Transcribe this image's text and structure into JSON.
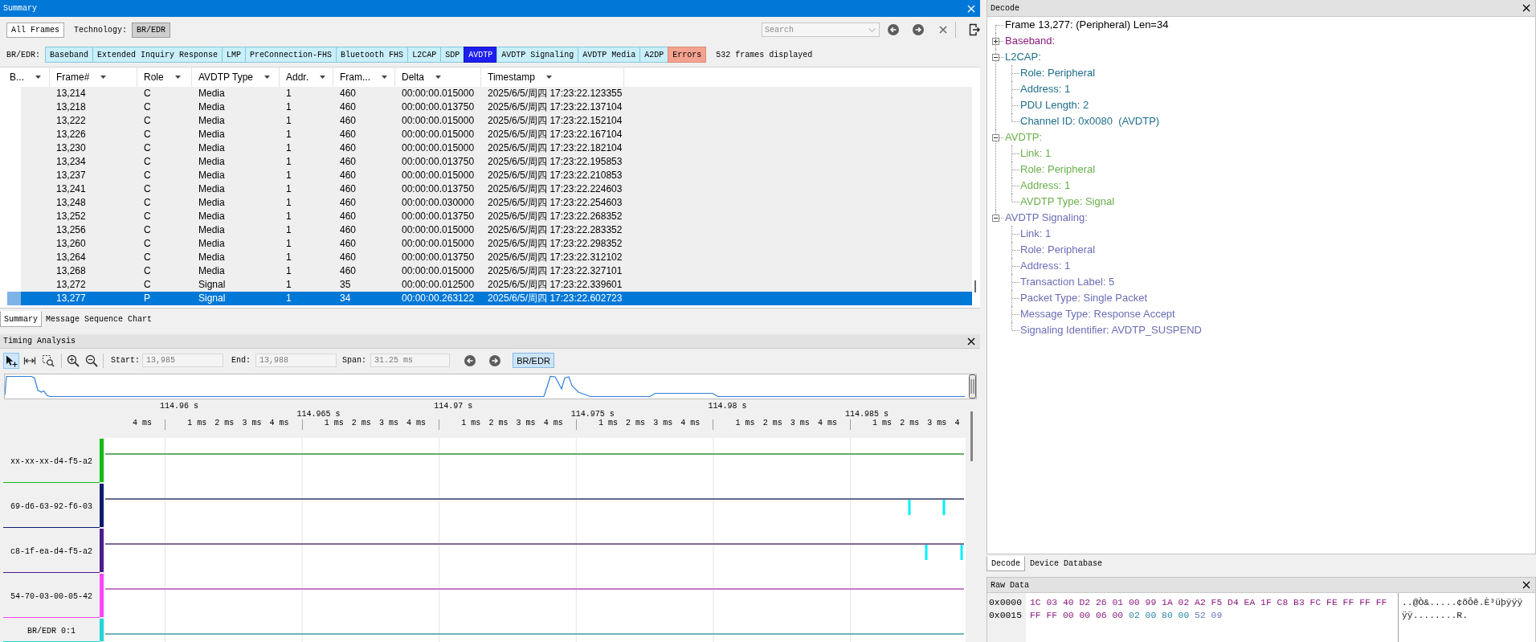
{
  "summary": {
    "title": "Summary",
    "all_frames_button": "All Frames",
    "technology_label": "Technology:",
    "technology_button": "BR/EDR",
    "search": {
      "placeholder": "Search"
    },
    "protocol_label": "BR/EDR:",
    "protocol_tabs": [
      {
        "label": "Baseband",
        "kind": "protocol",
        "selected": false
      },
      {
        "label": "Extended Inquiry Response",
        "kind": "protocol",
        "selected": false
      },
      {
        "label": "LMP",
        "kind": "protocol",
        "selected": false
      },
      {
        "label": "PreConnection-FHS",
        "kind": "protocol",
        "selected": false
      },
      {
        "label": "Bluetooth FHS",
        "kind": "protocol",
        "selected": false
      },
      {
        "label": "L2CAP",
        "kind": "protocol",
        "selected": false
      },
      {
        "label": "SDP",
        "kind": "protocol",
        "selected": false
      },
      {
        "label": "AVDTP",
        "kind": "protocol",
        "selected": true
      },
      {
        "label": "AVDTP Signaling",
        "kind": "protocol",
        "selected": false
      },
      {
        "label": "AVDTP Media",
        "kind": "protocol",
        "selected": false
      },
      {
        "label": "A2DP",
        "kind": "protocol",
        "selected": false
      },
      {
        "label": "Errors",
        "kind": "error",
        "selected": false
      }
    ],
    "frames_count": "532 frames displayed",
    "table": {
      "columns": [
        "B...",
        "Frame#",
        "Role",
        "AVDTP Type",
        "Addr.",
        "Fram...",
        "Delta",
        "Timestamp"
      ],
      "rows": [
        {
          "cells": [
            "",
            "13,214",
            "C",
            "Media",
            "1",
            "460",
            "00:00:00.015000",
            "2025/6/5/周四 17:23:22.123355"
          ],
          "selected": false
        },
        {
          "cells": [
            "",
            "13,218",
            "C",
            "Media",
            "1",
            "460",
            "00:00:00.013750",
            "2025/6/5/周四 17:23:22.137104"
          ],
          "selected": false
        },
        {
          "cells": [
            "",
            "13,222",
            "C",
            "Media",
            "1",
            "460",
            "00:00:00.015000",
            "2025/6/5/周四 17:23:22.152104"
          ],
          "selected": false
        },
        {
          "cells": [
            "",
            "13,226",
            "C",
            "Media",
            "1",
            "460",
            "00:00:00.015000",
            "2025/6/5/周四 17:23:22.167104"
          ],
          "selected": false
        },
        {
          "cells": [
            "",
            "13,230",
            "C",
            "Media",
            "1",
            "460",
            "00:00:00.015000",
            "2025/6/5/周四 17:23:22.182104"
          ],
          "selected": false
        },
        {
          "cells": [
            "",
            "13,234",
            "C",
            "Media",
            "1",
            "460",
            "00:00:00.013750",
            "2025/6/5/周四 17:23:22.195853"
          ],
          "selected": false
        },
        {
          "cells": [
            "",
            "13,237",
            "C",
            "Media",
            "1",
            "460",
            "00:00:00.015000",
            "2025/6/5/周四 17:23:22.210853"
          ],
          "selected": false
        },
        {
          "cells": [
            "",
            "13,241",
            "C",
            "Media",
            "1",
            "460",
            "00:00:00.013750",
            "2025/6/5/周四 17:23:22.224603"
          ],
          "selected": false
        },
        {
          "cells": [
            "",
            "13,248",
            "C",
            "Media",
            "1",
            "460",
            "00:00:00.030000",
            "2025/6/5/周四 17:23:22.254603"
          ],
          "selected": false
        },
        {
          "cells": [
            "",
            "13,252",
            "C",
            "Media",
            "1",
            "460",
            "00:00:00.013750",
            "2025/6/5/周四 17:23:22.268352"
          ],
          "selected": false
        },
        {
          "cells": [
            "",
            "13,256",
            "C",
            "Media",
            "1",
            "460",
            "00:00:00.015000",
            "2025/6/5/周四 17:23:22.283352"
          ],
          "selected": false
        },
        {
          "cells": [
            "",
            "13,260",
            "C",
            "Media",
            "1",
            "460",
            "00:00:00.015000",
            "2025/6/5/周四 17:23:22.298352"
          ],
          "selected": false
        },
        {
          "cells": [
            "",
            "13,264",
            "C",
            "Media",
            "1",
            "460",
            "00:00:00.013750",
            "2025/6/5/周四 17:23:22.312102"
          ],
          "selected": false
        },
        {
          "cells": [
            "",
            "13,268",
            "C",
            "Media",
            "1",
            "460",
            "00:00:00.015000",
            "2025/6/5/周四 17:23:22.327101"
          ],
          "selected": false
        },
        {
          "cells": [
            "",
            "13,272",
            "C",
            "Signal",
            "1",
            "35",
            "00:00:00.012500",
            "2025/6/5/周四 17:23:22.339601"
          ],
          "selected": false
        },
        {
          "cells": [
            "",
            "13,277",
            "P",
            "Signal",
            "1",
            "34",
            "00:00:00.263122",
            "2025/6/5/周四 17:23:22.602723"
          ],
          "selected": true
        }
      ]
    },
    "view_tabs": [
      {
        "label": "Summary",
        "selected": true
      },
      {
        "label": "Message Sequence Chart",
        "selected": false
      }
    ]
  },
  "timing": {
    "title": "Timing Analysis",
    "modes": [
      {
        "selected": true
      },
      {
        "selected": false
      },
      {
        "selected": false
      }
    ],
    "start": {
      "label": "Start:",
      "value": "13,985"
    },
    "end": {
      "label": "End:",
      "value": "13,988"
    },
    "span": {
      "label": "Span:",
      "value": "31.25 ms"
    },
    "technology_button": "BR/EDR",
    "ruler_labels": [
      "4 ms",
      "114.96 s",
      "1 ms",
      "2 ms",
      "3 ms",
      "4 ms",
      "114.965 s",
      "1 ms",
      "2 ms",
      "3 ms",
      "4 ms",
      "114.97 s",
      "1 ms",
      "2 ms",
      "3 ms",
      "4 ms",
      "114.975 s",
      "1 ms",
      "2 ms",
      "3 ms",
      "4 ms",
      "114.98 s",
      "1 ms",
      "2 ms",
      "3 ms",
      "4 ms",
      "114.985 s",
      "1 ms",
      "2 ms",
      "3 ms",
      "4"
    ],
    "lanes": [
      {
        "label": "xx-xx-xx-d4-f5-a2",
        "color": "#14bb14"
      },
      {
        "label": "69-d6-63-92-f6-03",
        "color": "#0b1a6e"
      },
      {
        "label": "c8-1f-ea-d4-f5-a2",
        "color": "#4b1c8c"
      },
      {
        "label": "54-70-03-00-05-42",
        "color": "#ff44ff"
      },
      {
        "label": "BR/EDR 0:1",
        "color": "#22d6d6"
      }
    ]
  },
  "decode": {
    "title": "Decode",
    "tree": [
      {
        "label": "Frame 13,277: (Peripheral) Len=34",
        "color": "#000000"
      },
      {
        "label": "Baseband:",
        "color": "#8b1a80",
        "expanded": false
      },
      {
        "label": "L2CAP:",
        "color": "#1f6e8c",
        "expanded": true,
        "children": [
          {
            "label": "Role: Peripheral"
          },
          {
            "label": "Address: 1"
          },
          {
            "label": "PDU Length: 2"
          },
          {
            "label": "Channel ID: 0x0080  (AVDTP)"
          }
        ]
      },
      {
        "label": "AVDTP:",
        "color": "#6aaf4a",
        "expanded": true,
        "children": [
          {
            "label": "Link: 1"
          },
          {
            "label": "Role: Peripheral"
          },
          {
            "label": "Address: 1"
          },
          {
            "label": "AVDTP Type: Signal"
          }
        ]
      },
      {
        "label": "AVDTP Signaling:",
        "color": "#6b6db5",
        "expanded": true,
        "children": [
          {
            "label": "Link: 1"
          },
          {
            "label": "Role: Peripheral"
          },
          {
            "label": "Address: 1"
          },
          {
            "label": "Transaction Label: 5"
          },
          {
            "label": "Packet Type: Single Packet"
          },
          {
            "label": "Message Type: Response Accept"
          },
          {
            "label": "Signaling Identifier: AVDTP_SUSPEND"
          }
        ]
      }
    ],
    "tabs": [
      {
        "label": "Decode",
        "selected": true
      },
      {
        "label": "Device Database",
        "selected": false
      }
    ]
  },
  "raw_data": {
    "title": "Raw Data",
    "rows": [
      {
        "offset": "0x0000",
        "segments": [
          {
            "text": "1C 03 40 D2 26 01 00 99 1A 02 A2 F5 D4 EA 1F C8 B3 FC FE FF FF FF",
            "color": "#8b1a80"
          }
        ],
        "ascii": "..@Ò&.....¢õÔê.È³üþÿÿÿ"
      },
      {
        "offset": "0x0015",
        "segments": [
          {
            "text": "FF FF 00 00 06 00",
            "color": "#8b1a80"
          },
          {
            "text": "02 00 80 00",
            "color": "#2a8aa6"
          },
          {
            "text": "52 09",
            "color": "#6b78bd"
          }
        ],
        "ascii": "ÿÿ........R."
      }
    ]
  }
}
